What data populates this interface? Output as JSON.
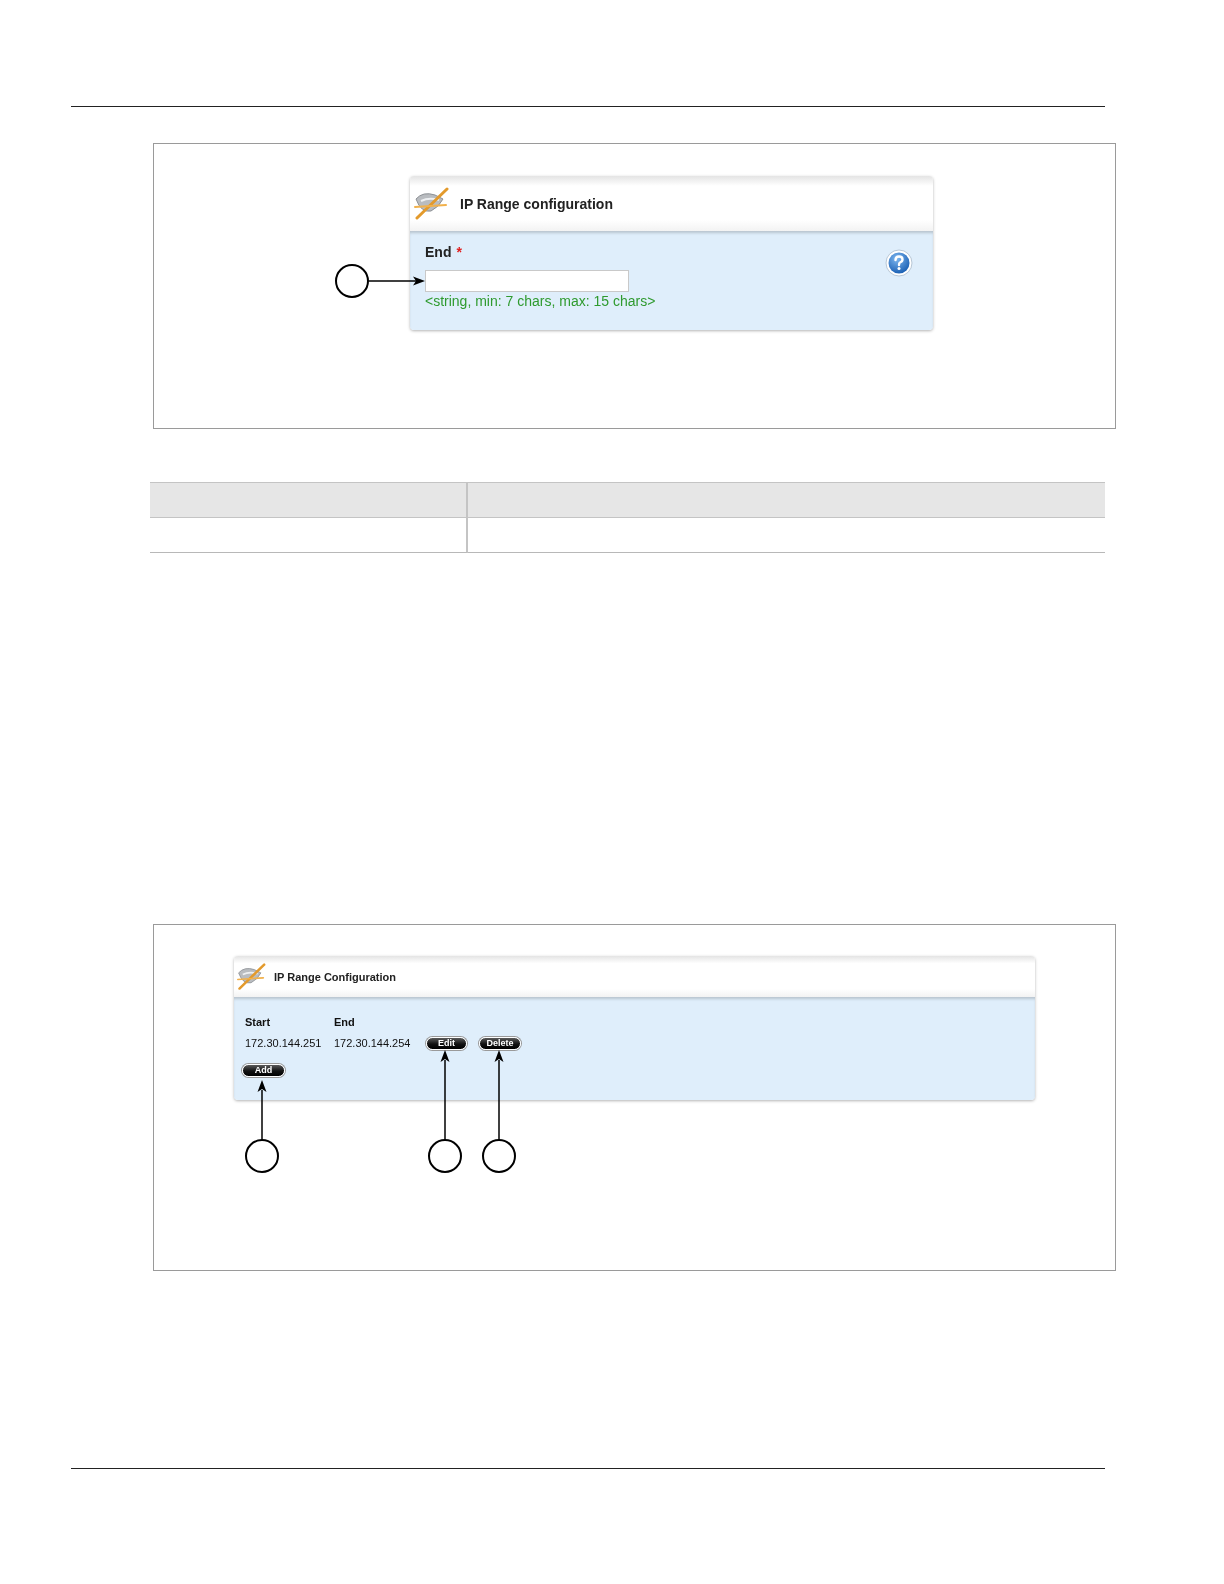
{
  "figure_1": {
    "panel": {
      "title": "IP Range configuration",
      "field": {
        "label": "End",
        "required_mark": "*",
        "hint": "<string, min: 7 chars, max: 15 chars>"
      }
    }
  },
  "figure_2": {
    "panel": {
      "title": "IP Range Configuration",
      "columns": [
        "Start",
        "End"
      ],
      "rows": [
        {
          "cells": [
            "172.30.144.251",
            "172.30.144.254"
          ],
          "actions": [
            "Edit",
            "Delete"
          ]
        }
      ],
      "add_button": "Add"
    }
  }
}
